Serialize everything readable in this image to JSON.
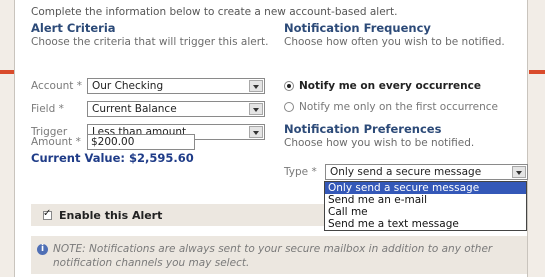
{
  "intro": "Complete the information below to create a new account-based alert.",
  "criteria": {
    "heading": "Alert Criteria",
    "hint": "Choose the criteria that will trigger this alert.",
    "account": {
      "label": "Account",
      "value": "Our Checking"
    },
    "field": {
      "label": "Field",
      "value": "Current Balance"
    },
    "trigger": {
      "label": "Trigger",
      "value": "Less than amount"
    },
    "amount": {
      "label": "Amount",
      "value": "$200.00"
    },
    "required_mark": "*",
    "current_value": "Current Value: $2,595.60"
  },
  "frequency": {
    "heading": "Notification Frequency",
    "hint": "Choose how often you wish to be notified.",
    "options": [
      {
        "label": "Notify me on every occurrence",
        "selected": true
      },
      {
        "label": "Notify me only on the first occurrence",
        "selected": false
      }
    ]
  },
  "preferences": {
    "heading": "Notification Preferences",
    "hint": "Choose how you wish to be notified.",
    "type_label": "Type",
    "type_value": "Only send a secure message",
    "options": [
      {
        "label": "Only send a secure message",
        "selected": true
      },
      {
        "label": "Send me an e-mail",
        "selected": false
      },
      {
        "label": "Call me",
        "selected": false
      },
      {
        "label": "Send me a text message",
        "selected": false
      }
    ]
  },
  "enable": {
    "label": "Enable this Alert",
    "checked": true
  },
  "note": "NOTE: Notifications are always sent to your secure mailbox in addition to any other notification channels you may select.",
  "colors": {
    "accent": "#d94b2b",
    "heading": "#2c4a78",
    "current_value": "#1f3c88",
    "dropdown_highlight": "#3458b8"
  },
  "icons": {
    "info": "info-icon",
    "dropdown": "chevron-down-icon",
    "checkbox": "checkmark-icon"
  }
}
